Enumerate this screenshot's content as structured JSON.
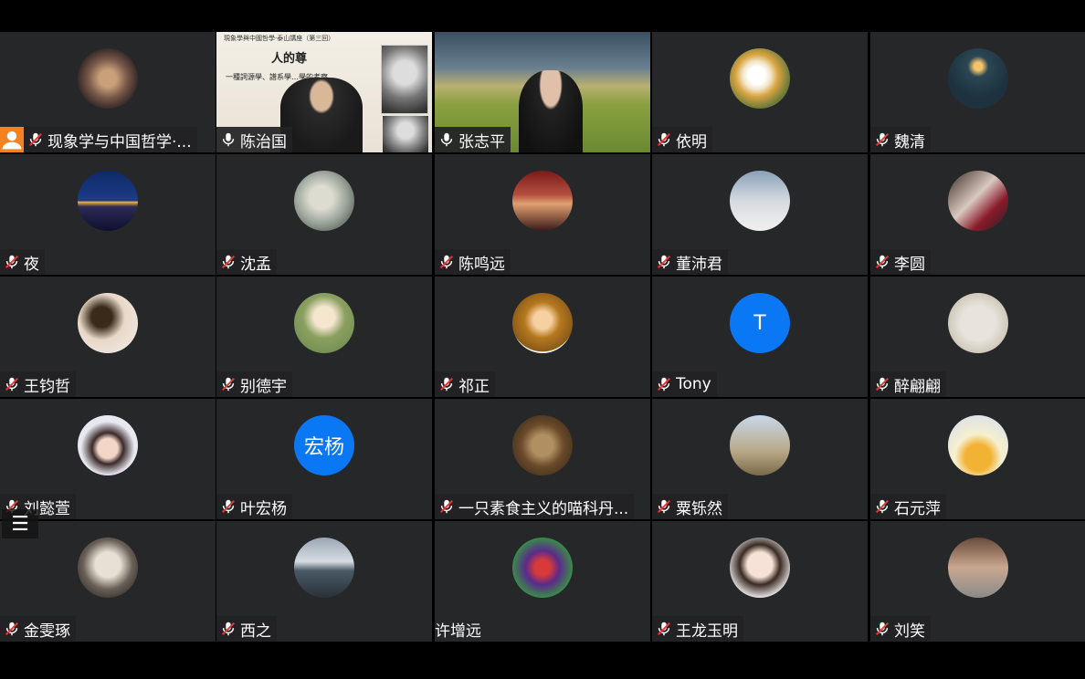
{
  "colors": {
    "tile_bg": "#262729",
    "accent": "#0a78f5",
    "host": "#f58220",
    "speaking": "#20c05b"
  },
  "slide": {
    "header": "現象學與中國哲學·泰山講座（第三回）",
    "title": "人的尊",
    "subtitle": "一種詞源學、譜系學…學的考察"
  },
  "participants": [
    {
      "name": "现象学与中国哲学·...",
      "muted": true,
      "host": true,
      "avatar": "image"
    },
    {
      "name": "陈治国",
      "muted": false,
      "video": "slide"
    },
    {
      "name": "张志平",
      "muted": false,
      "video": "landscape"
    },
    {
      "name": "依明",
      "muted": true,
      "avatar": "image"
    },
    {
      "name": "魏清",
      "muted": true,
      "avatar": "image"
    },
    {
      "name": "夜",
      "muted": true,
      "avatar": "image"
    },
    {
      "name": "沈孟",
      "muted": true,
      "avatar": "image"
    },
    {
      "name": "陈鸣远",
      "muted": true,
      "avatar": "image"
    },
    {
      "name": "董沛君",
      "muted": true,
      "avatar": "image"
    },
    {
      "name": "李圆",
      "muted": true,
      "avatar": "image"
    },
    {
      "name": "王钧哲",
      "muted": true,
      "avatar": "image"
    },
    {
      "name": "别德宇",
      "muted": true,
      "avatar": "image"
    },
    {
      "name": "祁正",
      "muted": true,
      "avatar": "image"
    },
    {
      "name": "Tony",
      "muted": true,
      "avatar": "letter",
      "letter": "T"
    },
    {
      "name": "醉翩翩",
      "muted": true,
      "avatar": "image"
    },
    {
      "name": "刘懿萱",
      "muted": true,
      "avatar": "image"
    },
    {
      "name": "叶宏杨",
      "muted": true,
      "avatar": "letter",
      "letter": "宏杨"
    },
    {
      "name": "一只素食主义的喵科丹...",
      "muted": true,
      "avatar": "image"
    },
    {
      "name": "粟铄然",
      "muted": true,
      "avatar": "image"
    },
    {
      "name": "石元萍",
      "muted": true,
      "avatar": "image"
    },
    {
      "name": "金雯琢",
      "muted": true,
      "avatar": "image"
    },
    {
      "name": "西之",
      "muted": true,
      "avatar": "image"
    },
    {
      "name": "许增远",
      "muted": null,
      "avatar": "image"
    },
    {
      "name": "王龙玉明",
      "muted": true,
      "avatar": "image"
    },
    {
      "name": "刘笑",
      "muted": true,
      "avatar": "image"
    }
  ]
}
